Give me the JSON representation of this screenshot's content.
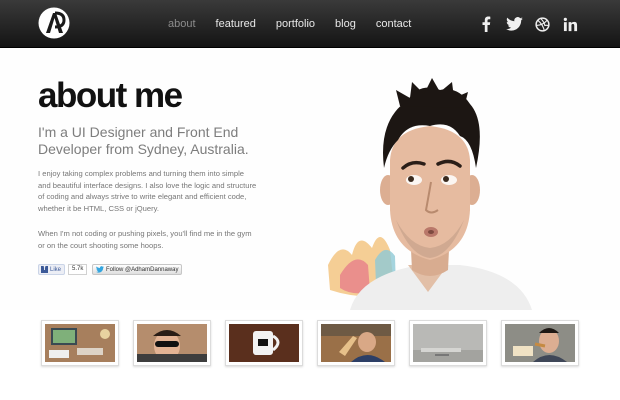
{
  "nav": {
    "items": [
      {
        "label": "about",
        "active": true
      },
      {
        "label": "featured",
        "active": false
      },
      {
        "label": "portfolio",
        "active": false
      },
      {
        "label": "blog",
        "active": false
      },
      {
        "label": "contact",
        "active": false
      }
    ]
  },
  "social": [
    "facebook-icon",
    "twitter-icon",
    "dribbble-icon",
    "linkedin-icon"
  ],
  "hero": {
    "title": "about me",
    "subtitle": "I'm a UI Designer and Front End Developer from Sydney, Australia.",
    "paragraph1": "I enjoy taking complex problems and turning them into simple and beautiful interface designs. I also love the logic and structure of coding and always strive to write elegant and efficient code, whether it be HTML, CSS or jQuery.",
    "paragraph2": "When I'm not coding or pushing pixels, you'll find me in the gym or on the court shooting some hoops."
  },
  "buttons": {
    "like_label": "Like",
    "like_count": "5.7k",
    "follow_label": "Follow @AdhamDannaway"
  },
  "colors": {
    "header_bg": "#1e1e1e",
    "nav_active": "#8c8c8c",
    "nav_text": "#e8e8e8",
    "title": "#111111",
    "subtitle": "#7d7d7d"
  }
}
